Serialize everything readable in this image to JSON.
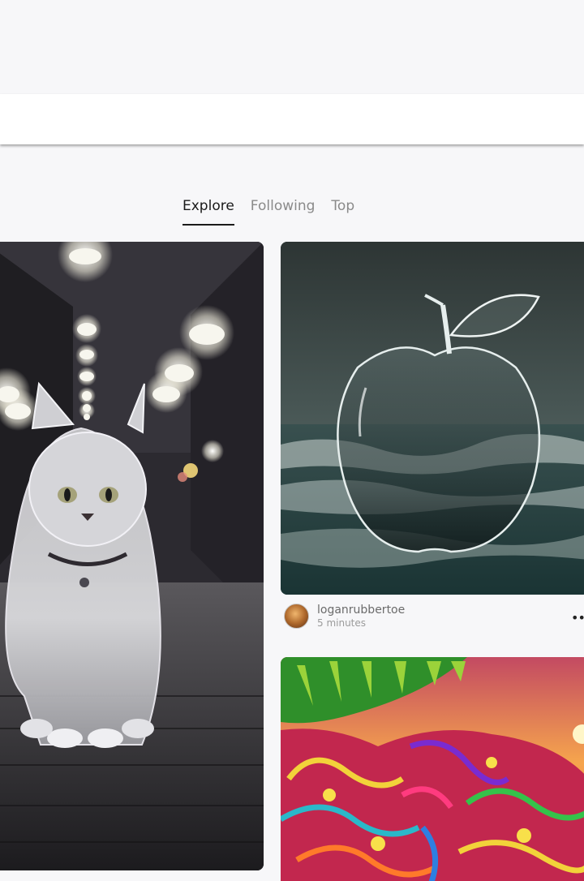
{
  "tabs": [
    {
      "label": "Explore",
      "active": true
    },
    {
      "label": "Following",
      "active": false
    },
    {
      "label": "Top",
      "active": false
    }
  ],
  "posts": [
    {
      "image": "cat-in-alley",
      "author": "",
      "time": ""
    },
    {
      "image": "glass-apple-ocean",
      "author": "loganrubbertoe",
      "time": "5 minutes"
    },
    {
      "image": "psychedelic-elephant",
      "author": "",
      "time": ""
    }
  ],
  "more_label": "•••",
  "colors": {
    "background": "#f7f7f9",
    "active_tab": "#1a1a1a",
    "inactive_tab": "#8a8a8a"
  }
}
